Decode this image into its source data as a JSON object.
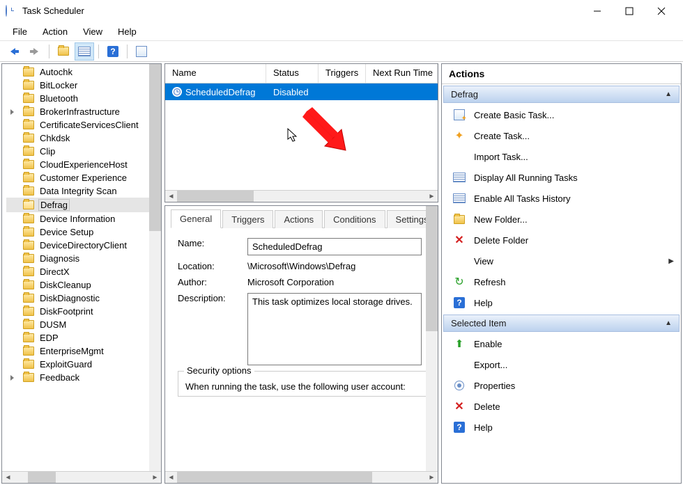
{
  "window": {
    "title": "Task Scheduler"
  },
  "menu": {
    "file": "File",
    "action": "Action",
    "view": "View",
    "help": "Help"
  },
  "tree": {
    "items": [
      {
        "label": "Autochk"
      },
      {
        "label": "BitLocker"
      },
      {
        "label": "Bluetooth"
      },
      {
        "label": "BrokerInfrastructure",
        "expandable": true
      },
      {
        "label": "CertificateServicesClient"
      },
      {
        "label": "Chkdsk"
      },
      {
        "label": "Clip"
      },
      {
        "label": "CloudExperienceHost"
      },
      {
        "label": "Customer Experience"
      },
      {
        "label": "Data Integrity Scan"
      },
      {
        "label": "Defrag",
        "selected": true
      },
      {
        "label": "Device Information"
      },
      {
        "label": "Device Setup"
      },
      {
        "label": "DeviceDirectoryClient"
      },
      {
        "label": "Diagnosis"
      },
      {
        "label": "DirectX"
      },
      {
        "label": "DiskCleanup"
      },
      {
        "label": "DiskDiagnostic"
      },
      {
        "label": "DiskFootprint"
      },
      {
        "label": "DUSM"
      },
      {
        "label": "EDP"
      },
      {
        "label": "EnterpriseMgmt"
      },
      {
        "label": "ExploitGuard"
      },
      {
        "label": "Feedback",
        "expandable": true
      }
    ]
  },
  "list": {
    "columns": {
      "name": "Name",
      "status": "Status",
      "triggers": "Triggers",
      "next": "Next Run Time"
    },
    "row": {
      "name": "ScheduledDefrag",
      "status": "Disabled"
    }
  },
  "details": {
    "tabs": {
      "general": "General",
      "triggers": "Triggers",
      "actions": "Actions",
      "conditions": "Conditions",
      "settings": "Settings"
    },
    "name_lbl": "Name:",
    "name_val": "ScheduledDefrag",
    "location_lbl": "Location:",
    "location_val": "\\Microsoft\\Windows\\Defrag",
    "author_lbl": "Author:",
    "author_val": "Microsoft Corporation",
    "desc_lbl": "Description:",
    "desc_val": "This task optimizes local storage drives.",
    "security_legend": "Security options",
    "security_line": "When running the task, use the following user account:"
  },
  "actions": {
    "header": "Actions",
    "group1": "Defrag",
    "group2": "Selected Item",
    "create_basic": "Create Basic Task...",
    "create_task": "Create Task...",
    "import_task": "Import Task...",
    "display_running": "Display All Running Tasks",
    "enable_history": "Enable All Tasks History",
    "new_folder": "New Folder...",
    "delete_folder": "Delete Folder",
    "view": "View",
    "refresh": "Refresh",
    "help": "Help",
    "enable": "Enable",
    "export": "Export...",
    "properties": "Properties",
    "delete": "Delete"
  }
}
